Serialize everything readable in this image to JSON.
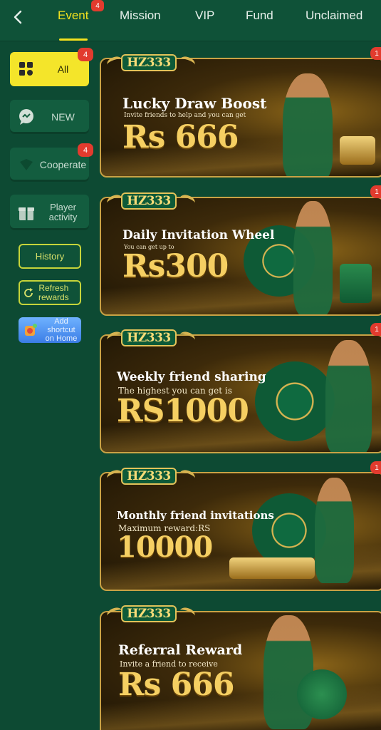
{
  "header": {
    "tabs": [
      {
        "label": "Event",
        "badge": "4",
        "active": true
      },
      {
        "label": "Mission"
      },
      {
        "label": "VIP"
      },
      {
        "label": "Fund"
      },
      {
        "label": "Unclaimed"
      }
    ]
  },
  "sidebar": {
    "all": {
      "label": "All",
      "badge": "4"
    },
    "new": {
      "label": "NEW"
    },
    "cooperate": {
      "label": "Cooperate",
      "badge": "4"
    },
    "player_activity": {
      "label_line1": "Player",
      "label_line2": "activity"
    },
    "history": {
      "label": "History"
    },
    "refresh": {
      "label_line1": "Refresh",
      "label_line2": "rewards"
    },
    "add": {
      "label_line1": "Add shortcut",
      "label_line2": "on Home"
    }
  },
  "banners": [
    {
      "logo": "HZ333",
      "badge": "1",
      "title": "Lucky Draw Boost",
      "subtitle": "Invite friends to help and you can get",
      "amount": "Rs 666"
    },
    {
      "logo": "HZ333",
      "badge": "1",
      "title": "Daily Invitation Wheel",
      "subtitle": "You can get up to",
      "amount": "Rs300"
    },
    {
      "logo": "HZ333",
      "badge": "1",
      "title": "Weekly friend sharing",
      "subtitle": "The highest you can get is",
      "amount": "RS1000"
    },
    {
      "logo": "HZ333",
      "badge": "1",
      "title": "Monthly friend invitations",
      "subtitle": "Maximum reward:RS",
      "amount": "10000"
    },
    {
      "logo": "HZ333",
      "title": "Referral Reward",
      "subtitle": "Invite a friend to receive",
      "amount": "Rs 666"
    }
  ],
  "colors": {
    "background": "#0d4a33",
    "accent": "#f3e21f",
    "badge": "#e23b2e",
    "gold": "#f5cf62"
  },
  "icons": {
    "back": "chevron-left-icon",
    "all": "grid-icon",
    "new": "chat-icon",
    "cooperate": "shield-icon",
    "player_activity": "gift-icon",
    "refresh": "refresh-icon",
    "add": "app-shortcut-icon"
  }
}
